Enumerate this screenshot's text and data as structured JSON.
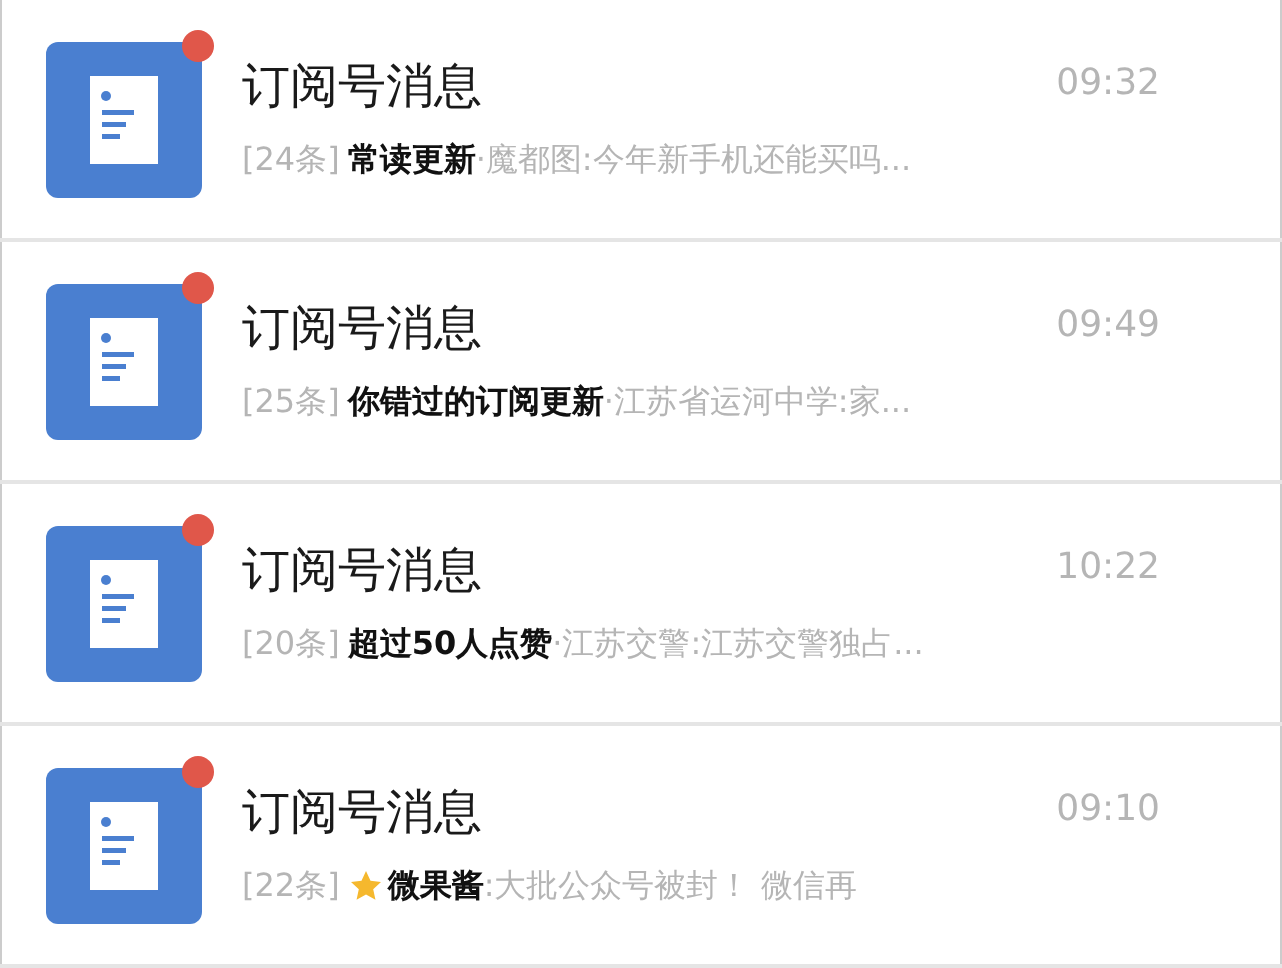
{
  "conversations": [
    {
      "title": "订阅号消息",
      "time": "09:32",
      "count": "[24条]",
      "starred": false,
      "unread": true,
      "tag": "常读更新",
      "preview": "·魔都图:今年新手机还能买吗..."
    },
    {
      "title": "订阅号消息",
      "time": "09:49",
      "count": "[25条]",
      "starred": false,
      "unread": true,
      "tag": "你错过的订阅更新",
      "preview": "·江苏省运河中学:家..."
    },
    {
      "title": "订阅号消息",
      "time": "10:22",
      "count": "[20条]",
      "starred": false,
      "unread": true,
      "tag": "超过50人点赞",
      "preview": "·江苏交警:江苏交警独占..."
    },
    {
      "title": "订阅号消息",
      "time": "09:10",
      "count": "[22条]",
      "starred": true,
      "unread": true,
      "tag": "微果酱",
      "preview": ":大批公众号被封！ 微信再"
    }
  ]
}
